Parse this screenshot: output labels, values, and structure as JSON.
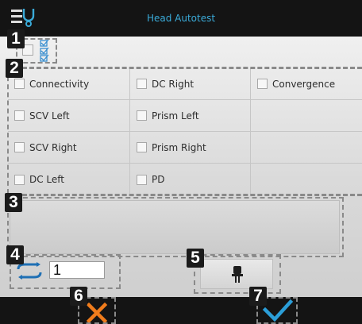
{
  "window": {
    "title": "Head Autotest"
  },
  "icons": {
    "app": "settings-stethoscope-icon",
    "checklist": "checklist-icon",
    "repeat": "repeat-icon",
    "probe": "probe-connector-icon",
    "cancel": "close-icon",
    "confirm": "checkmark-icon"
  },
  "callouts": [
    "1",
    "2",
    "3",
    "4",
    "5",
    "6",
    "7"
  ],
  "tests": [
    [
      "Connectivity",
      "DC Right",
      "Convergence"
    ],
    [
      "SCV Left",
      "Prism Left",
      ""
    ],
    [
      "SCV Right",
      "Prism Right",
      ""
    ],
    [
      "DC Left",
      "PD",
      ""
    ]
  ],
  "repeat": {
    "value": "1"
  },
  "colors": {
    "accent": "#3aaad8",
    "cancel": "#f07c1c",
    "confirm": "#2b9ed8",
    "bar": "#141414"
  }
}
